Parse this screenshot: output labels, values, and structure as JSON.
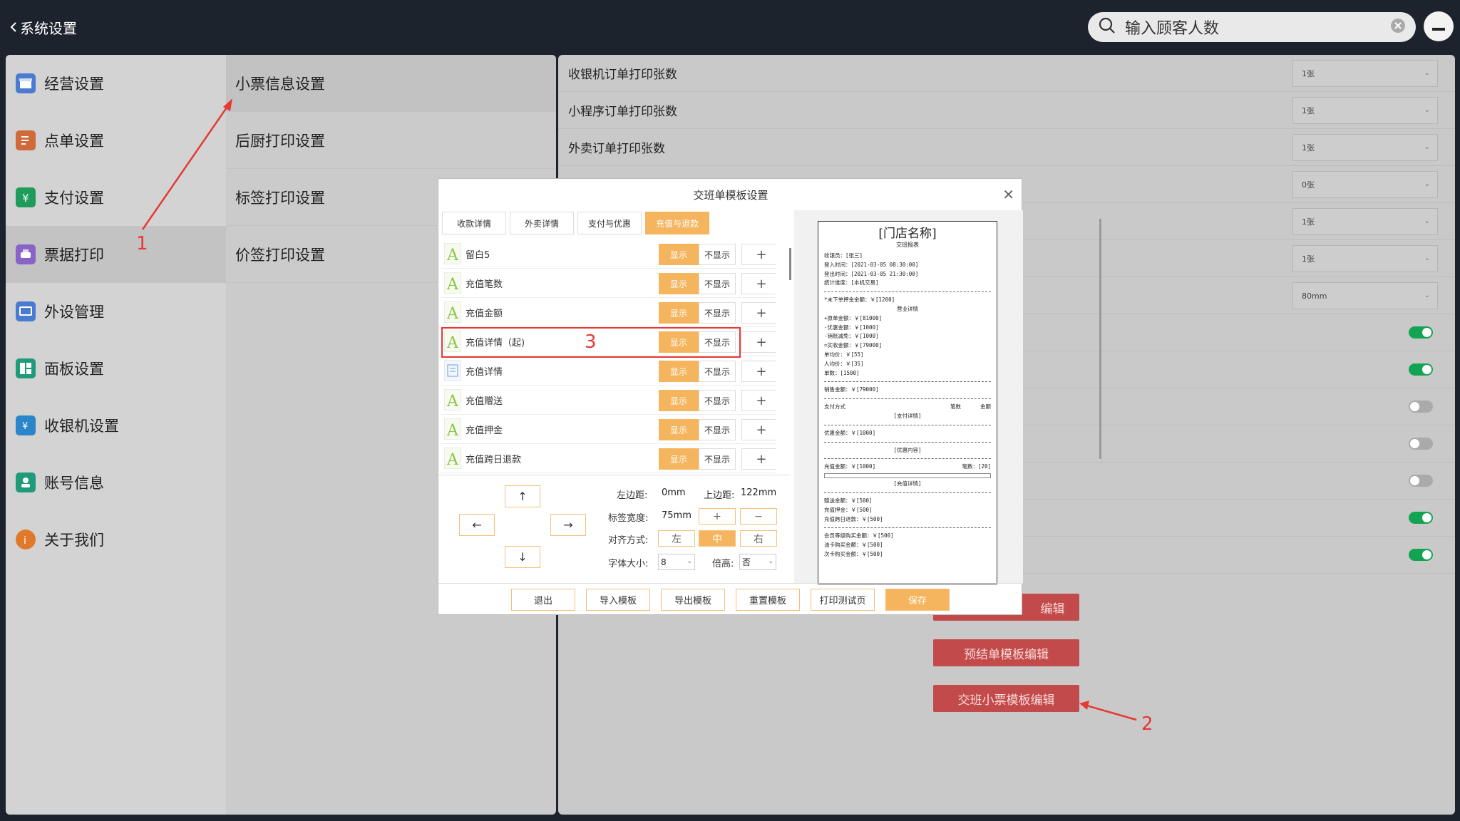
{
  "header": {
    "back_label": "系统设置",
    "search_placeholder": "输入顾客人数"
  },
  "menu1": [
    {
      "label": "经营设置",
      "icon": "shop-icon",
      "color": "#4a7bd0"
    },
    {
      "label": "点单设置",
      "icon": "order-icon",
      "color": "#d06a3a"
    },
    {
      "label": "支付设置",
      "icon": "yuan-icon",
      "color": "#1f9b5a"
    },
    {
      "label": "票据打印",
      "icon": "printer-icon",
      "color": "#8a63c8"
    },
    {
      "label": "外设管理",
      "icon": "device-icon",
      "color": "#4a7bd0"
    },
    {
      "label": "面板设置",
      "icon": "panel-icon",
      "color": "#1f9b7a"
    },
    {
      "label": "收银机设置",
      "icon": "cashier-icon",
      "color": "#2a86c8"
    },
    {
      "label": "账号信息",
      "icon": "account-icon",
      "color": "#1f9b7a"
    },
    {
      "label": "关于我们",
      "icon": "info-icon",
      "color": "#e07a2a"
    }
  ],
  "menu2": [
    "小票信息设置",
    "后厨打印设置",
    "标签打印设置",
    "价签打印设置"
  ],
  "settings": {
    "rows": [
      {
        "label": "收银机订单打印张数",
        "value": "1张"
      },
      {
        "label": "小程序订单打印张数",
        "value": "1张"
      },
      {
        "label": "外卖订单打印张数",
        "value": "1张"
      },
      {
        "label": "",
        "value": "0张"
      },
      {
        "label": "",
        "value": "1张"
      },
      {
        "label": "",
        "value": "1张"
      },
      {
        "label": "",
        "value": "80mm"
      }
    ],
    "toggles": [
      true,
      true,
      false,
      false,
      false,
      true,
      true
    ],
    "buttons": [
      "编辑",
      "预结单模板编辑",
      "交班小票模板编辑"
    ]
  },
  "dialog": {
    "title": "交班单模板设置",
    "tabs": [
      "收款详情",
      "外卖详情",
      "支付与优惠",
      "充值与退款"
    ],
    "show_label": "显示",
    "hide_label": "不显示",
    "items": [
      {
        "label": "留白5",
        "icon": "text-a-icon"
      },
      {
        "label": "充值笔数",
        "icon": "text-a-icon"
      },
      {
        "label": "充值金额",
        "icon": "text-a-icon"
      },
      {
        "label": "充值详情（起)",
        "icon": "text-a-icon"
      },
      {
        "label": "充值详情",
        "icon": "list-doc-icon"
      },
      {
        "label": "充值赠送",
        "icon": "text-a-icon"
      },
      {
        "label": "充值押金",
        "icon": "text-a-icon"
      },
      {
        "label": "充值跨日退款",
        "icon": "text-a-icon"
      }
    ],
    "props": {
      "left_margin_label": "左边距:",
      "left_margin": "0mm",
      "top_margin_label": "上边距:",
      "top_margin": "122mm",
      "width_label": "标签宽度:",
      "width": "75mm",
      "align_label": "对齐方式:",
      "align_left": "左",
      "align_center": "中",
      "align_right": "右",
      "font_label": "字体大小:",
      "font_size": "8",
      "double_label": "倍高:",
      "double": "否"
    },
    "bottom_buttons": [
      "退出",
      "导入模板",
      "导出模板",
      "重置模板",
      "打印测试页",
      "保存"
    ],
    "receipt": {
      "store": "[门店名称]",
      "subtitle": "交班报表",
      "lines1": [
        "收银员：[张三]",
        "登入时间：[2021-03-05 08:30:00]",
        "登出时间：[2021-03-05 21:30:00]",
        "统计维度：[本机交易]"
      ],
      "unpaid": "*未下单押金金额：￥[1200]",
      "business_title": "营业详情",
      "lines2": [
        "+原单金额：￥[81000]",
        "-优惠金额：￥[1000]",
        "-销账减免：￥[1000]",
        "=实收金额：￥[79000]",
        "单均价：￥[55]",
        "人均价：￥[35]",
        "单数：[1500]"
      ],
      "sales": "销售金额：￥[79000]",
      "pay_method": "支付方式",
      "count": "笔数",
      "amount": "金额",
      "pay_detail": "[支付详情]",
      "discount": "优惠金额：￥[1000]",
      "discount_content": "[优惠内容]",
      "recharge_amount": "充值金额：￥[1000]",
      "recharge_count": "笔数：[20]",
      "recharge_detail": "[充值详情]",
      "lines3": [
        "赠送金额：￥[500]",
        "充值押金：￥[500]",
        "充值跨日退款：￥[500]"
      ],
      "lines4": [
        "会员等级购买金额：￥[500]",
        "油卡购买金额：￥[500]",
        "次卡购买金额：￥[500]"
      ]
    }
  },
  "annotations": [
    "1",
    "2",
    "3"
  ]
}
